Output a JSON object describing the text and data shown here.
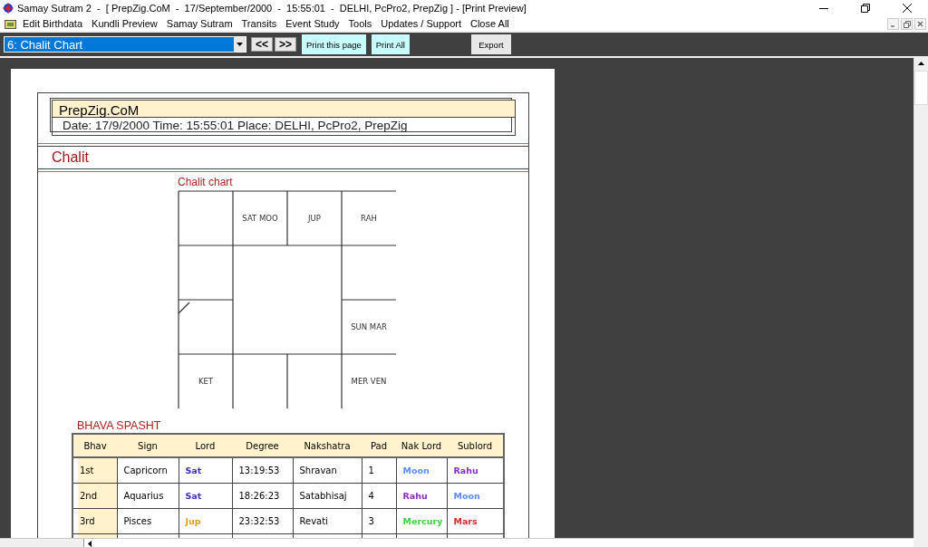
{
  "window": {
    "title": "Samay Sutram 2  -  [ PrepZig.CoM  -  17/September/2000  -  15:55:01  -  DELHI, PcPro2, PrepZig ] - [Print Preview]"
  },
  "menu": [
    "Edit Birthdata",
    "Kundli Preview",
    "Samay Sutram",
    "Transits",
    "Event Study",
    "Tools",
    "Updates / Support",
    "Close All"
  ],
  "toolbar": {
    "page_select": "6: Chalit Chart",
    "prev": "<<",
    "next": ">>",
    "print_page": "Print this page",
    "print_all": "Print All",
    "export": "Export"
  },
  "page": {
    "brand": "PrepZig.CoM",
    "details": "Date: 17/9/2000  Time: 15:55:01  Place: DELHI, PcPro2, PrepZig",
    "section": "Chalit",
    "chart_title": "Chalit chart",
    "houses": [
      {
        "kind": "top2",
        "planets": "SAT MOO"
      },
      {
        "kind": "top3",
        "planets": "JUP"
      },
      {
        "kind": "top4",
        "planets": "RAH"
      },
      {
        "kind": "right3",
        "planets": "SUN MAR"
      },
      {
        "kind": "bottom1",
        "planets": "KET"
      },
      {
        "kind": "bottom4",
        "planets": "MER VEN"
      }
    ],
    "table_title": "BHAVA SPASHT",
    "columns": [
      "Bhav",
      "Sign",
      "Lord",
      "Degree",
      "Nakshatra",
      "Pad",
      "Nak Lord",
      "Sublord"
    ],
    "rows": [
      {
        "bhav": "1st",
        "sign": "Capricorn",
        "lord": {
          "text": "Sat",
          "color": "#3a2fc0"
        },
        "degree": "13:19:53",
        "nakshatra": "Shravan",
        "pad": "1",
        "nak_lord": {
          "text": "Moon",
          "color": "#5a8cff"
        },
        "sublord": {
          "text": "Rahu",
          "color": "#8a2cc8"
        }
      },
      {
        "bhav": "2nd",
        "sign": "Aquarius",
        "lord": {
          "text": "Sat",
          "color": "#3a2fc0"
        },
        "degree": "18:26:23",
        "nakshatra": "Satabhisaj",
        "pad": "4",
        "nak_lord": {
          "text": "Rahu",
          "color": "#8a2cc8"
        },
        "sublord": {
          "text": "Moon",
          "color": "#5a8cff"
        }
      },
      {
        "bhav": "3rd",
        "sign": "Pisces",
        "lord": {
          "text": "Jup",
          "color": "#e0a020"
        },
        "degree": "23:32:53",
        "nakshatra": "Revati",
        "pad": "3",
        "nak_lord": {
          "text": "Mercury",
          "color": "#3cd23c"
        },
        "sublord": {
          "text": "Mars",
          "color": "#d82828"
        }
      },
      {}
    ]
  }
}
